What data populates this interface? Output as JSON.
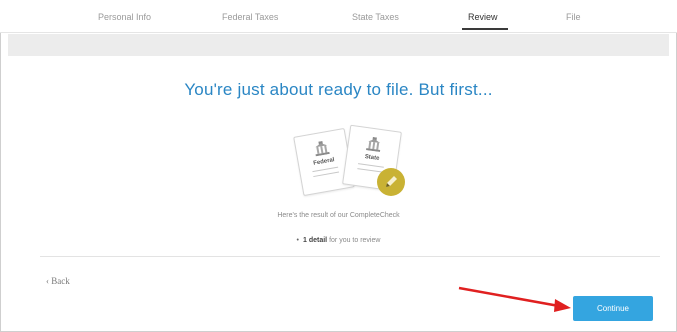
{
  "nav": {
    "steps": [
      {
        "label": "Personal Info"
      },
      {
        "label": "Federal Taxes"
      },
      {
        "label": "State Taxes"
      },
      {
        "label": "Review"
      },
      {
        "label": "File"
      }
    ],
    "active_step": "Review"
  },
  "main": {
    "heading": "You're just about ready to file. But first...",
    "cards": {
      "federal_label": "Federal",
      "state_label": "State"
    },
    "result_text": "Here's the result of our CompleteCheck",
    "detail_count": "1 detail",
    "detail_rest": "for you to review"
  },
  "footer": {
    "back_label": "‹ Back",
    "continue_label": "Continue"
  },
  "colors": {
    "accent_blue": "#2a86c4",
    "button_blue": "#34a5e0",
    "badge_gold": "#c9b234",
    "annotation_red": "#e02020"
  }
}
